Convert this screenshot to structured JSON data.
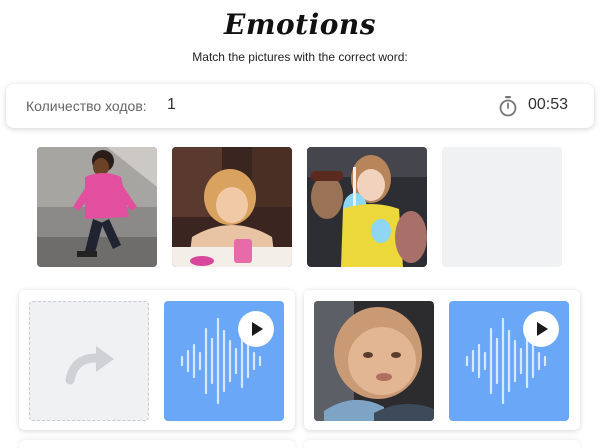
{
  "header": {
    "title": "Emotions",
    "subtitle": "Match the pictures with the correct word:"
  },
  "status": {
    "moves_label": "Количество ходов:",
    "moves_value": "1",
    "timer_icon": "stopwatch-icon",
    "timer_value": "00:53"
  },
  "pictures": [
    {
      "name": "photo-girl-pink-jacket",
      "state": "filled"
    },
    {
      "name": "photo-crying-girl",
      "state": "filled"
    },
    {
      "name": "photo-girl-cotton-candy",
      "state": "filled"
    },
    {
      "name": "empty-photo-slot",
      "state": "empty"
    }
  ],
  "match_cards": [
    {
      "picture_state": "empty",
      "drop_icon": "redo-arrow-icon",
      "audio": "sound-wave-icon",
      "play_icon": "play-icon"
    },
    {
      "picture_state": "filled",
      "picture_name": "photo-baby-face",
      "audio": "sound-wave-icon",
      "play_icon": "play-icon"
    }
  ],
  "colors": {
    "audio_background": "#6aa8f7",
    "empty_slot": "#f0f1f3",
    "title": "#111111"
  }
}
